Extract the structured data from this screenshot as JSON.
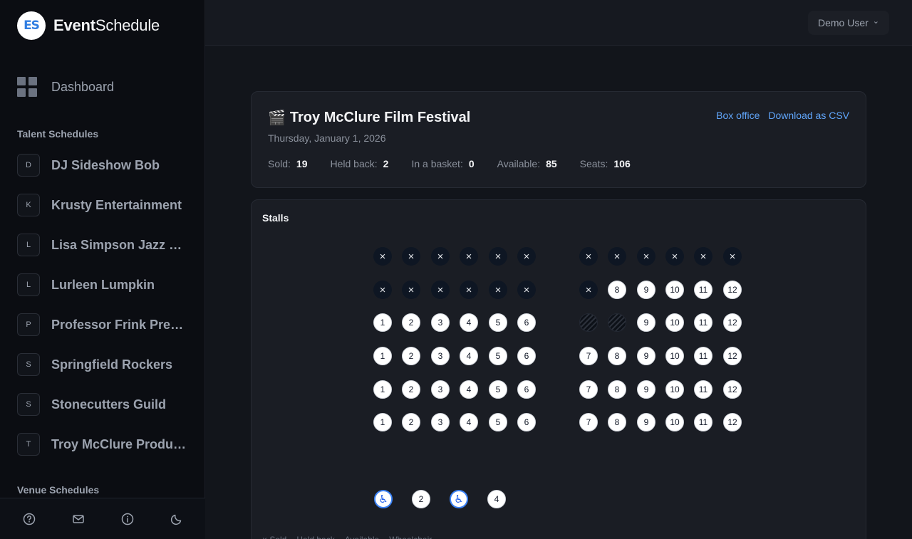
{
  "app": {
    "logo_mark": "ES",
    "name_bold": "Event",
    "name_rest": "Schedule"
  },
  "sidebar": {
    "dashboard_label": "Dashboard",
    "talent_title": "Talent Schedules",
    "talent": [
      {
        "initial": "D",
        "label": "DJ Sideshow Bob"
      },
      {
        "initial": "K",
        "label": "Krusty Entertainment"
      },
      {
        "initial": "L",
        "label": "Lisa Simpson Jazz Ensemble"
      },
      {
        "initial": "L",
        "label": "Lurleen Lumpkin"
      },
      {
        "initial": "P",
        "label": "Professor Frink Presents"
      },
      {
        "initial": "S",
        "label": "Springfield Rockers"
      },
      {
        "initial": "S",
        "label": "Stonecutters Guild"
      },
      {
        "initial": "T",
        "label": "Troy McClure Productions"
      }
    ],
    "venue_title": "Venue Schedules",
    "footer_icons": [
      "help-icon",
      "mail-icon",
      "info-icon",
      "moon-icon"
    ]
  },
  "header": {
    "user_label": "Demo User",
    "user_caret": "⌄"
  },
  "event": {
    "emoji": "🎬",
    "title": "Troy McClure Film Festival",
    "date": "Thursday, January 1, 2026",
    "links": {
      "box_office": "Box office",
      "download_csv": "Download as CSV"
    },
    "stats": {
      "sold_label": "Sold:",
      "sold": "19",
      "held_label": "Held back:",
      "held": "2",
      "basket_label": "In a basket:",
      "basket": "0",
      "available_label": "Available:",
      "available": "85",
      "seats_label": "Seats:",
      "seats": "106"
    }
  },
  "seating": {
    "section_title": "Stalls",
    "status_colors": {
      "available": "#ffffff",
      "sold": "#0e1623",
      "wheelchair": "#3b82f6"
    },
    "sold_glyph": "×",
    "wheelchair_glyph": "♿",
    "rows": [
      [
        "sold",
        "sold",
        "sold",
        "sold",
        "sold",
        "sold",
        "sold",
        "sold",
        "sold",
        "sold",
        "sold",
        "sold"
      ],
      [
        "sold",
        "sold",
        "sold",
        "sold",
        "sold",
        "sold",
        "sold",
        "8",
        "9",
        "10",
        "11",
        "12"
      ],
      [
        "1",
        "2",
        "3",
        "4",
        "5",
        "6",
        "held",
        "held",
        "9",
        "10",
        "11",
        "12"
      ],
      [
        "1",
        "2",
        "3",
        "4",
        "5",
        "6",
        "7",
        "8",
        "9",
        "10",
        "11",
        "12"
      ],
      [
        "1",
        "2",
        "3",
        "4",
        "5",
        "6",
        "7",
        "8",
        "9",
        "10",
        "11",
        "12"
      ],
      [
        "1",
        "2",
        "3",
        "4",
        "5",
        "6",
        "7",
        "8",
        "9",
        "10",
        "11",
        "12"
      ]
    ],
    "wheelchair_row": [
      "wheelchair",
      "2",
      "wheelchair",
      "4"
    ],
    "legend": [
      "× Sold",
      "Held back",
      "Available",
      "Wheelchair"
    ]
  }
}
